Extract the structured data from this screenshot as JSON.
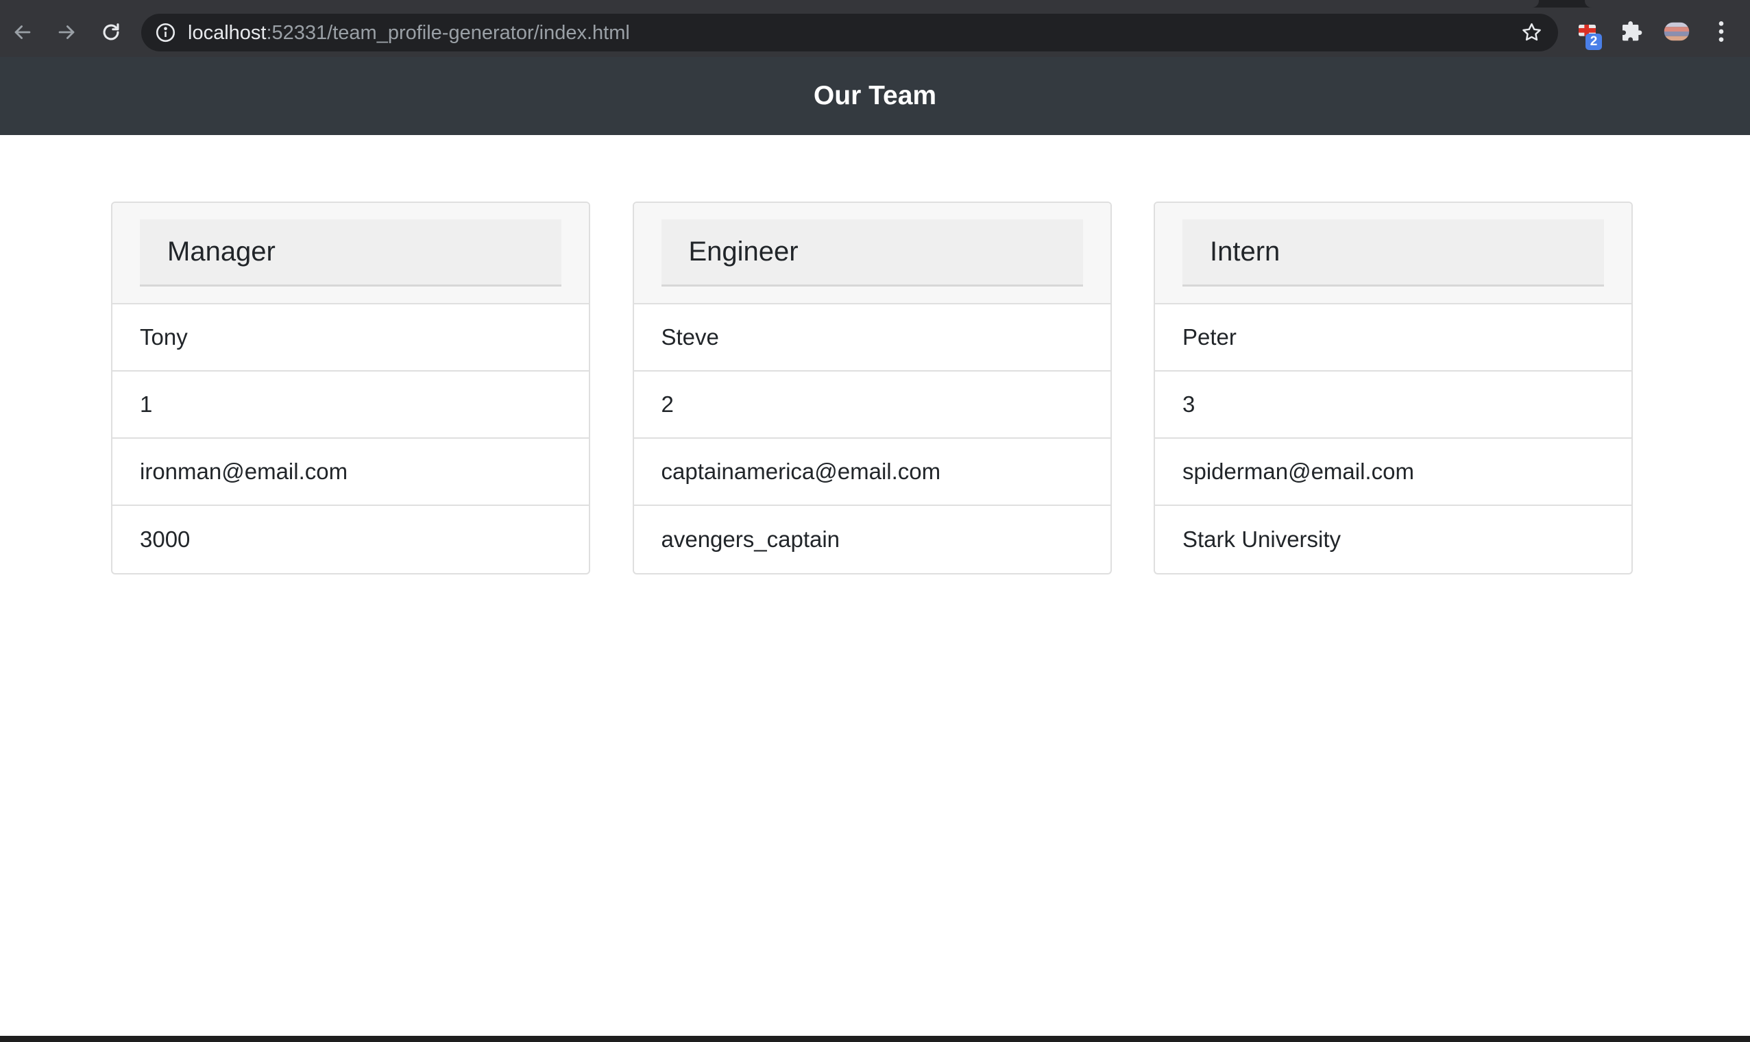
{
  "browser": {
    "url_host": "localhost",
    "url_path": ":52331/team_profile-generator/index.html",
    "extension_badge": "2"
  },
  "page": {
    "title": "Our Team"
  },
  "cards": [
    {
      "role": "Manager",
      "fields": [
        "Tony",
        "1",
        "ironman@email.com",
        "3000"
      ]
    },
    {
      "role": "Engineer",
      "fields": [
        "Steve",
        "2",
        "captainamerica@email.com",
        "avengers_captain"
      ]
    },
    {
      "role": "Intern",
      "fields": [
        "Peter",
        "3",
        "spiderman@email.com",
        "Stark University"
      ]
    }
  ],
  "colors": {
    "chrome_bg": "#35363a",
    "omnibox_bg": "#202124",
    "header_bg": "#343a40",
    "card_head_bg": "#f7f7f7",
    "border": "#dfdfdf"
  }
}
